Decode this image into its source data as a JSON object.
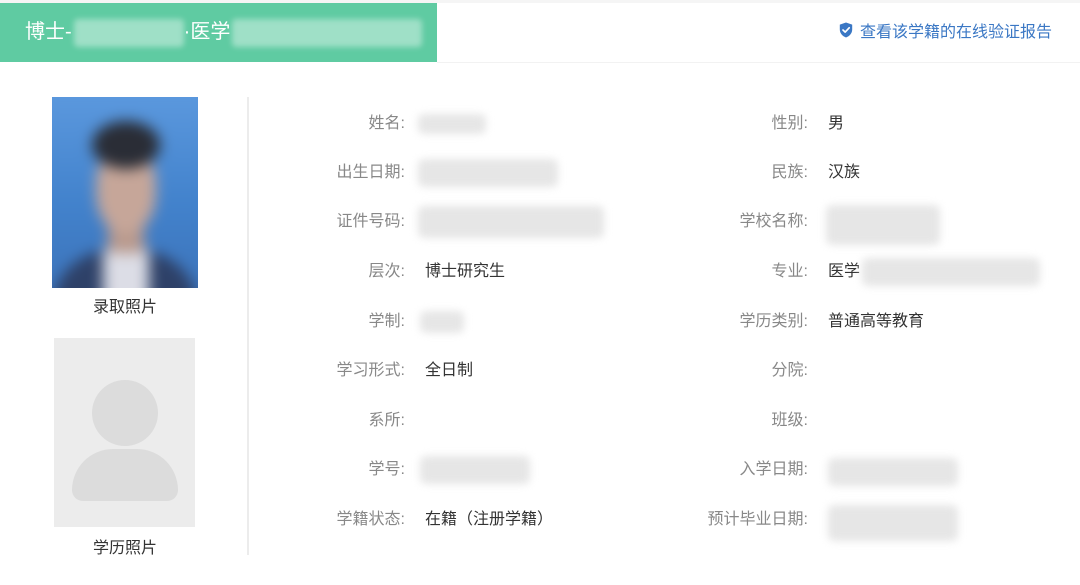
{
  "header": {
    "degree_text": "博士-",
    "major_text": "·医学",
    "school_redacted": true,
    "major_redacted": true
  },
  "verify_link": {
    "icon": "shield-check-icon",
    "label": "查看该学籍的在线验证报告"
  },
  "photos": {
    "admission": {
      "label": "录取照片"
    },
    "degree": {
      "label": "学历照片",
      "placeholder_icon": "avatar-placeholder-icon"
    }
  },
  "fields_left": [
    {
      "label": "姓名:",
      "value": "",
      "redacted": true
    },
    {
      "label": "出生日期:",
      "value": "",
      "redacted": true
    },
    {
      "label": "证件号码:",
      "value": "",
      "redacted": true
    },
    {
      "label": "层次:",
      "value": "博士研究生",
      "redacted": false
    },
    {
      "label": "学制:",
      "value": "",
      "redacted": true
    },
    {
      "label": "学习形式:",
      "value": "全日制",
      "redacted": false
    },
    {
      "label": "系所:",
      "value": "",
      "redacted": false
    },
    {
      "label": "学号:",
      "value": "",
      "redacted": true
    },
    {
      "label": "学籍状态:",
      "value": "在籍（注册学籍）",
      "redacted": false
    }
  ],
  "fields_right": [
    {
      "label": "性别:",
      "value": "男",
      "redacted": false
    },
    {
      "label": "民族:",
      "value": "汉族",
      "redacted": false
    },
    {
      "label": "学校名称:",
      "value": "",
      "redacted": true
    },
    {
      "label": "专业:",
      "value": "医学",
      "redacted": true
    },
    {
      "label": "学历类别:",
      "value": "普通高等教育",
      "redacted": false
    },
    {
      "label": "分院:",
      "value": "",
      "redacted": false
    },
    {
      "label": "班级:",
      "value": "",
      "redacted": false
    },
    {
      "label": "入学日期:",
      "value": "",
      "redacted": true
    },
    {
      "label": "预计毕业日期:",
      "value": "",
      "redacted": true
    }
  ],
  "colors": {
    "header_bg": "#5fcba2",
    "link": "#3a77c4",
    "label": "#888888",
    "value": "#333333"
  }
}
